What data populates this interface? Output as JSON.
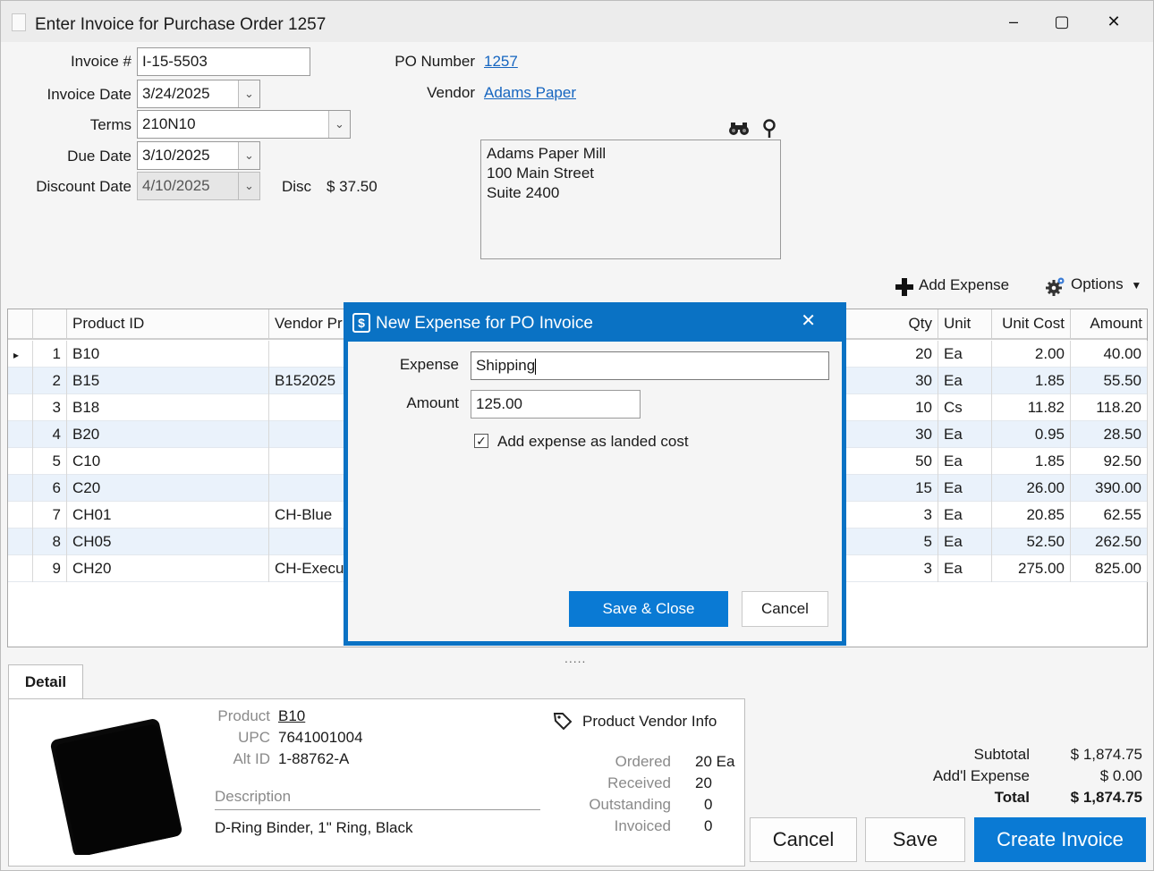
{
  "window": {
    "title": "Enter Invoice for Purchase Order 1257",
    "minimize_glyph": "–",
    "maximize_glyph": "▢",
    "close_glyph": "✕"
  },
  "header": {
    "invoice_label": "Invoice #",
    "invoice_value": "I-15-5503",
    "invoice_date_label": "Invoice Date",
    "invoice_date_value": "3/24/2025",
    "terms_label": "Terms",
    "terms_value": "210N10",
    "due_date_label": "Due Date",
    "due_date_value": "3/10/2025",
    "discount_date_label": "Discount Date",
    "discount_date_value": "4/10/2025",
    "disc_label": "Disc",
    "disc_value": "$ 37.50",
    "po_number_label": "PO Number",
    "po_number_value": "1257",
    "vendor_label": "Vendor",
    "vendor_value": "Adams Paper",
    "address_lines": [
      "Adams Paper Mill",
      "100 Main Street",
      "Suite 2400"
    ]
  },
  "toolbar": {
    "add_expense_label": "Add Expense",
    "options_label": "Options"
  },
  "grid": {
    "columns": [
      "",
      "",
      "Product ID",
      "Vendor Pr",
      "Qty",
      "Unit",
      "Unit Cost",
      "Amount"
    ],
    "rows": [
      {
        "num": "1",
        "product": "B10",
        "vendor_pr": "",
        "qty": "20",
        "unit": "Ea",
        "unit_cost": "2.00",
        "amount": "40.00"
      },
      {
        "num": "2",
        "product": "B15",
        "vendor_pr": "B152025",
        "qty": "30",
        "unit": "Ea",
        "unit_cost": "1.85",
        "amount": "55.50"
      },
      {
        "num": "3",
        "product": "B18",
        "vendor_pr": "",
        "qty": "10",
        "unit": "Cs",
        "unit_cost": "11.82",
        "amount": "118.20"
      },
      {
        "num": "4",
        "product": "B20",
        "vendor_pr": "",
        "qty": "30",
        "unit": "Ea",
        "unit_cost": "0.95",
        "amount": "28.50"
      },
      {
        "num": "5",
        "product": "C10",
        "vendor_pr": "",
        "qty": "50",
        "unit": "Ea",
        "unit_cost": "1.85",
        "amount": "92.50"
      },
      {
        "num": "6",
        "product": "C20",
        "vendor_pr": "",
        "qty": "15",
        "unit": "Ea",
        "unit_cost": "26.00",
        "amount": "390.00"
      },
      {
        "num": "7",
        "product": "CH01",
        "vendor_pr": "CH-Blue",
        "qty": "3",
        "unit": "Ea",
        "unit_cost": "20.85",
        "amount": "62.55"
      },
      {
        "num": "8",
        "product": "CH05",
        "vendor_pr": "",
        "qty": "5",
        "unit": "Ea",
        "unit_cost": "52.50",
        "amount": "262.50"
      },
      {
        "num": "9",
        "product": "CH20",
        "vendor_pr": "CH-Execu",
        "qty": "3",
        "unit": "Ea",
        "unit_cost": "275.00",
        "amount": "825.00"
      }
    ]
  },
  "detail": {
    "tab_label": "Detail",
    "product_label": "Product",
    "product_value": "B10",
    "upc_label": "UPC",
    "upc_value": "7641001004",
    "alt_id_label": "Alt ID",
    "alt_id_value": "1-88762-A",
    "description_label": "Description",
    "description_value": "D-Ring Binder, 1\" Ring, Black",
    "vendor_info_label": "Product Vendor Info",
    "ordered_label": "Ordered",
    "ordered_value": "20 Ea",
    "received_label": "Received",
    "received_value": "20",
    "outstanding_label": "Outstanding",
    "outstanding_value": "0",
    "invoiced_label": "Invoiced",
    "invoiced_value": "0"
  },
  "totals": {
    "subtotal_label": "Subtotal",
    "subtotal_value": "$ 1,874.75",
    "addl_expense_label": "Add'l Expense",
    "addl_expense_value": "$ 0.00",
    "total_label": "Total",
    "total_value": "$ 1,874.75"
  },
  "footer": {
    "cancel_label": "Cancel",
    "save_label": "Save",
    "create_label": "Create Invoice"
  },
  "modal": {
    "title": "New Expense for PO Invoice",
    "close_glyph": "✕",
    "expense_label": "Expense",
    "expense_value": "Shipping",
    "amount_label": "Amount",
    "amount_value": "125.00",
    "landed_cost_label": "Add expense as landed cost",
    "landed_cost_checked": true,
    "save_close_label": "Save & Close",
    "cancel_label": "Cancel"
  },
  "colors": {
    "accent": "#0a72c4",
    "link": "#1565c0",
    "row_alt": "#eaf2fb"
  }
}
